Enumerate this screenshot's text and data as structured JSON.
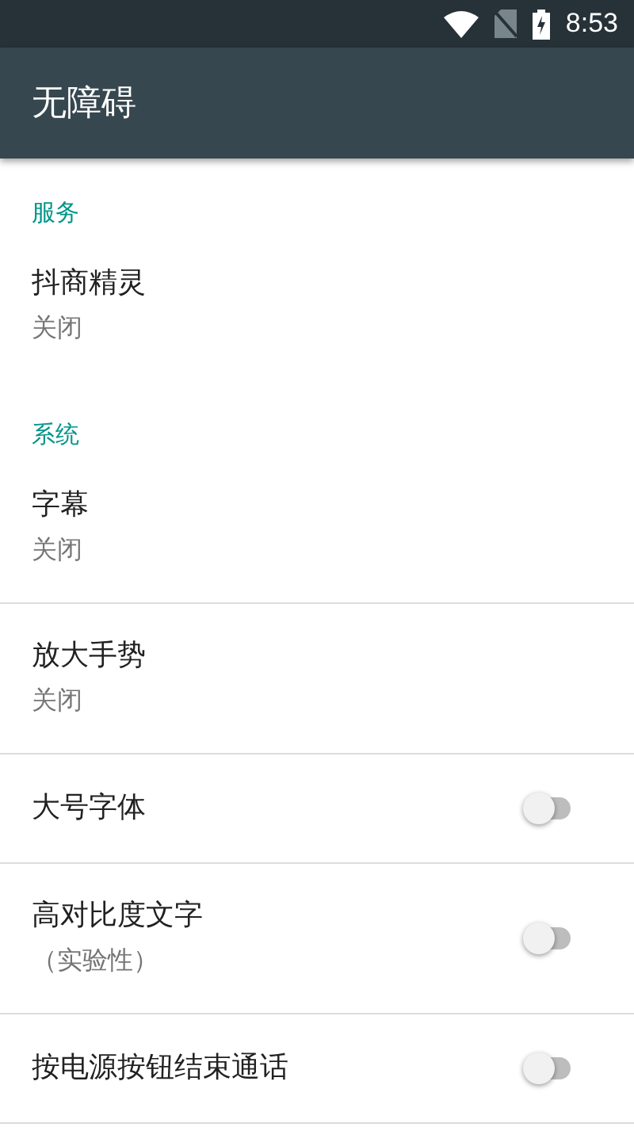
{
  "status_bar": {
    "time": "8:53"
  },
  "app_bar": {
    "title": "无障碍"
  },
  "sections": [
    {
      "header": "服务",
      "items": [
        {
          "kind": "text",
          "title": "抖商精灵",
          "summary": "关闭"
        }
      ]
    },
    {
      "header": "系统",
      "items": [
        {
          "kind": "text",
          "title": "字幕",
          "summary": "关闭"
        },
        {
          "kind": "text",
          "title": "放大手势",
          "summary": "关闭"
        },
        {
          "kind": "switch",
          "title": "大号字体",
          "on": false
        },
        {
          "kind": "switch",
          "title": "高对比度文字",
          "summary": "（实验性）",
          "on": false
        },
        {
          "kind": "switch",
          "title": "按电源按钮结束通话",
          "on": false
        }
      ]
    }
  ]
}
